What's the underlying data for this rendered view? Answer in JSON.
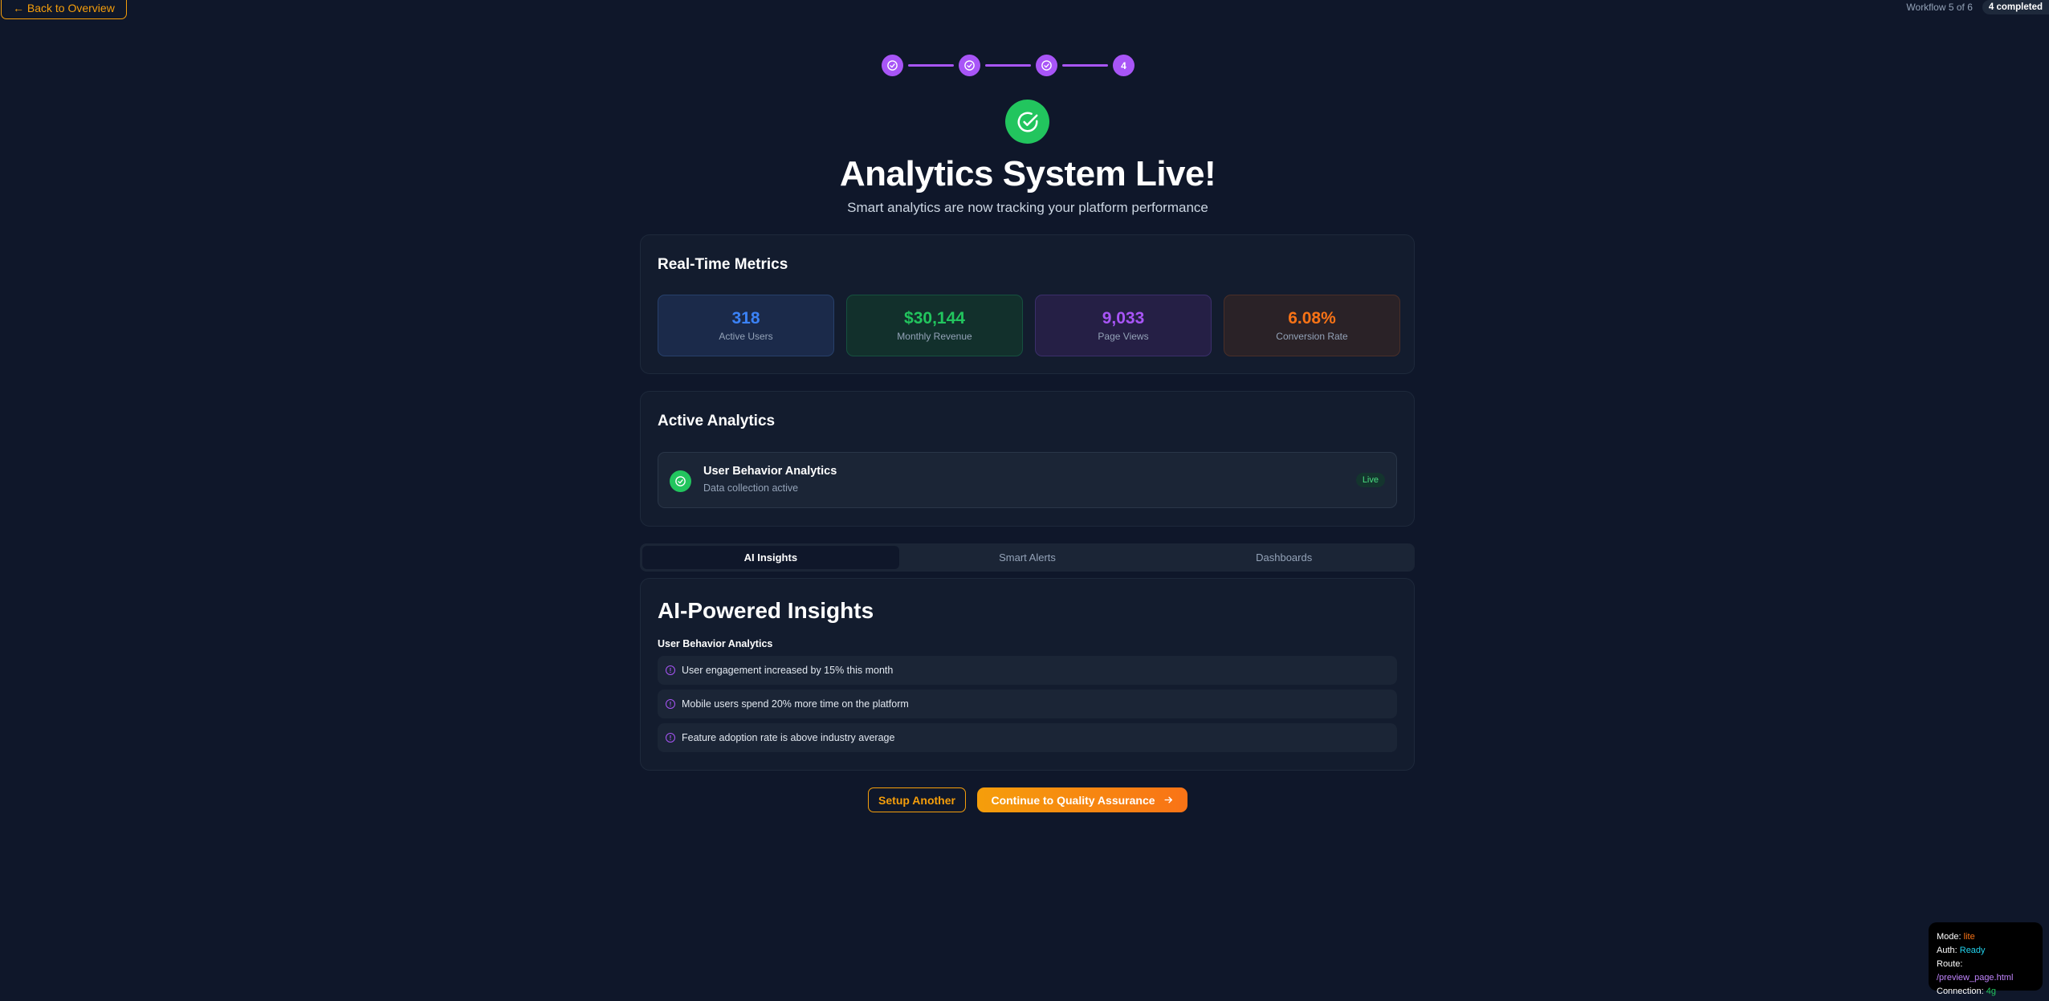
{
  "nav": {
    "back_label": "← Back to Overview"
  },
  "status": {
    "workflow_label": "Workflow 5 of 6",
    "completed_badge": "4 completed"
  },
  "steps": {
    "current_number": "4"
  },
  "hero": {
    "title": "Analytics System Live!",
    "subtitle": "Smart analytics are now tracking your platform performance",
    "icon": "check-circle-icon"
  },
  "metrics": {
    "title": "Real-Time Metrics",
    "items": [
      {
        "value": "318",
        "label": "Active Users",
        "color": "#3b82f6"
      },
      {
        "value": "$30,144",
        "label": "Monthly Revenue",
        "color": "#22c55e"
      },
      {
        "value": "9,033",
        "label": "Page Views",
        "color": "#a855f7"
      },
      {
        "value": "6.08%",
        "label": "Conversion Rate",
        "color": "#f97316"
      }
    ]
  },
  "active_analytics": {
    "title": "Active Analytics",
    "item": {
      "name": "User Behavior Analytics",
      "status": "Data collection active",
      "badge": "Live"
    }
  },
  "tabs": [
    "AI Insights",
    "Smart Alerts",
    "Dashboards"
  ],
  "insights": {
    "title": "AI-Powered Insights",
    "subtitle": "User Behavior Analytics",
    "items": [
      "User engagement increased by 15% this month",
      "Mobile users spend 20% more time on the platform",
      "Feature adoption rate is above industry average"
    ]
  },
  "actions": {
    "secondary_label": "Setup Another",
    "primary_label": "Continue to Quality Assurance"
  },
  "debug": {
    "mode_label": "Mode:",
    "mode_value": "lite",
    "auth_label": "Auth:",
    "auth_value": "Ready",
    "route_label": "Route:",
    "route_value": "/preview_page.html",
    "connection_label": "Connection:",
    "connection_value": "4g"
  },
  "colors": {
    "accent": "#f59e0b",
    "purple": "#a855f7",
    "success": "#22c55e",
    "background": "#0f172a"
  }
}
